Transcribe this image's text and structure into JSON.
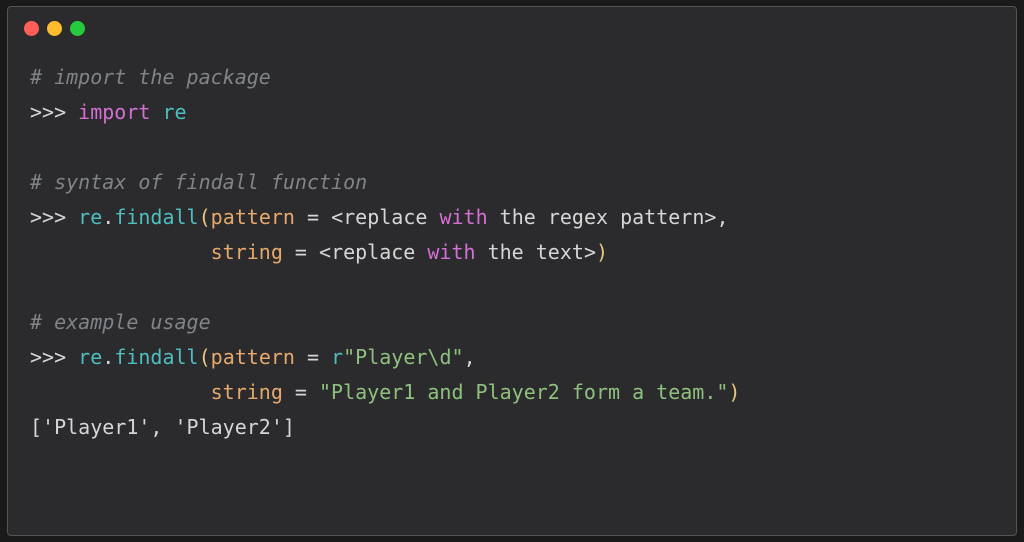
{
  "code_snippet": {
    "lines": [
      {
        "type": "comment",
        "text": "# import the package"
      },
      {
        "type": "import",
        "prompt": ">>> ",
        "keyword": "import",
        "module": "re"
      },
      {
        "type": "blank"
      },
      {
        "type": "comment",
        "text": "# syntax of findall function"
      },
      {
        "type": "call1",
        "prompt": ">>> ",
        "obj": "re",
        "func": "findall",
        "param1": "pattern",
        "val1": "<replace with the regex pattern>"
      },
      {
        "type": "cont1",
        "param2": "string",
        "val2": "<replace with the text>"
      },
      {
        "type": "blank"
      },
      {
        "type": "comment",
        "text": "# example usage"
      },
      {
        "type": "call2",
        "prompt": ">>> ",
        "obj": "re",
        "func": "findall",
        "param1": "pattern",
        "prefix": "r",
        "str1": "\"Player\\d\""
      },
      {
        "type": "cont2",
        "param2": "string",
        "str2": "\"Player1 and Player2 form a team.\""
      },
      {
        "type": "output",
        "text": "['Player1', 'Player2']"
      }
    ]
  },
  "colors": {
    "bg": "#2b2b2e",
    "comment": "#808488",
    "keyword": "#d46fd4",
    "module": "#4dbfbf",
    "param": "#e6a96b",
    "string": "#8fc17e",
    "bracket": "#e6c77e",
    "text": "#d6d6d6"
  }
}
